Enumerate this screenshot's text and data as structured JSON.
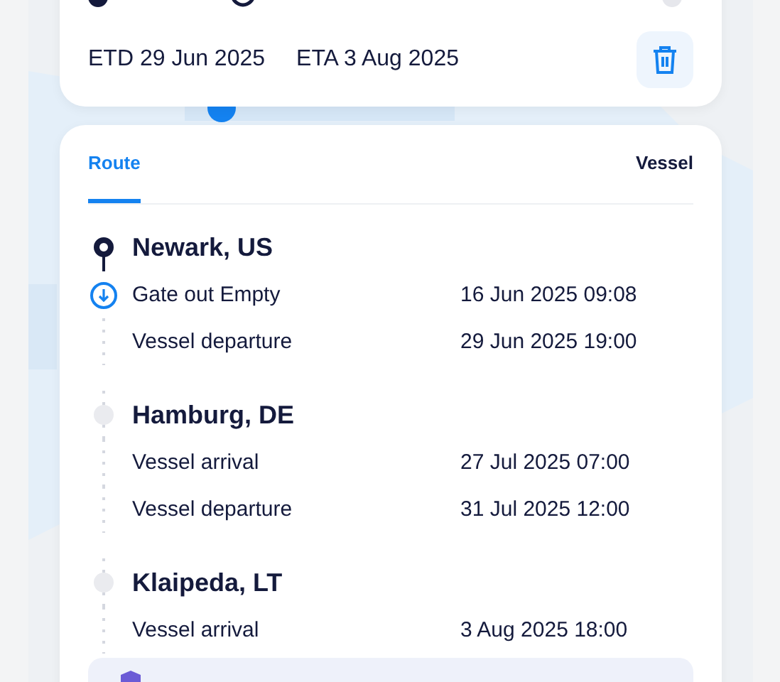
{
  "shipment": {
    "etd": "ETD 29 Jun 2025",
    "eta": "ETA 3 Aug 2025"
  },
  "tabs": [
    {
      "label": "Route",
      "selected": true
    },
    {
      "label": "Vessel",
      "selected": false
    }
  ],
  "stops": [
    {
      "name": "Newark, US",
      "reached": true,
      "events": [
        {
          "label": "Gate out Empty",
          "date": "16 Jun 2025 09:08",
          "done": true
        },
        {
          "label": "Vessel departure",
          "date": "29 Jun 2025 19:00",
          "done": false
        }
      ]
    },
    {
      "name": "Hamburg, DE",
      "reached": false,
      "events": [
        {
          "label": "Vessel arrival",
          "date": "27 Jul 2025 07:00",
          "done": false
        },
        {
          "label": "Vessel departure",
          "date": "31 Jul 2025 12:00",
          "done": false
        }
      ]
    },
    {
      "name": "Klaipeda, LT",
      "reached": false,
      "events": [
        {
          "label": "Vessel arrival",
          "date": "3 Aug 2025 18:00",
          "done": false
        }
      ]
    }
  ]
}
